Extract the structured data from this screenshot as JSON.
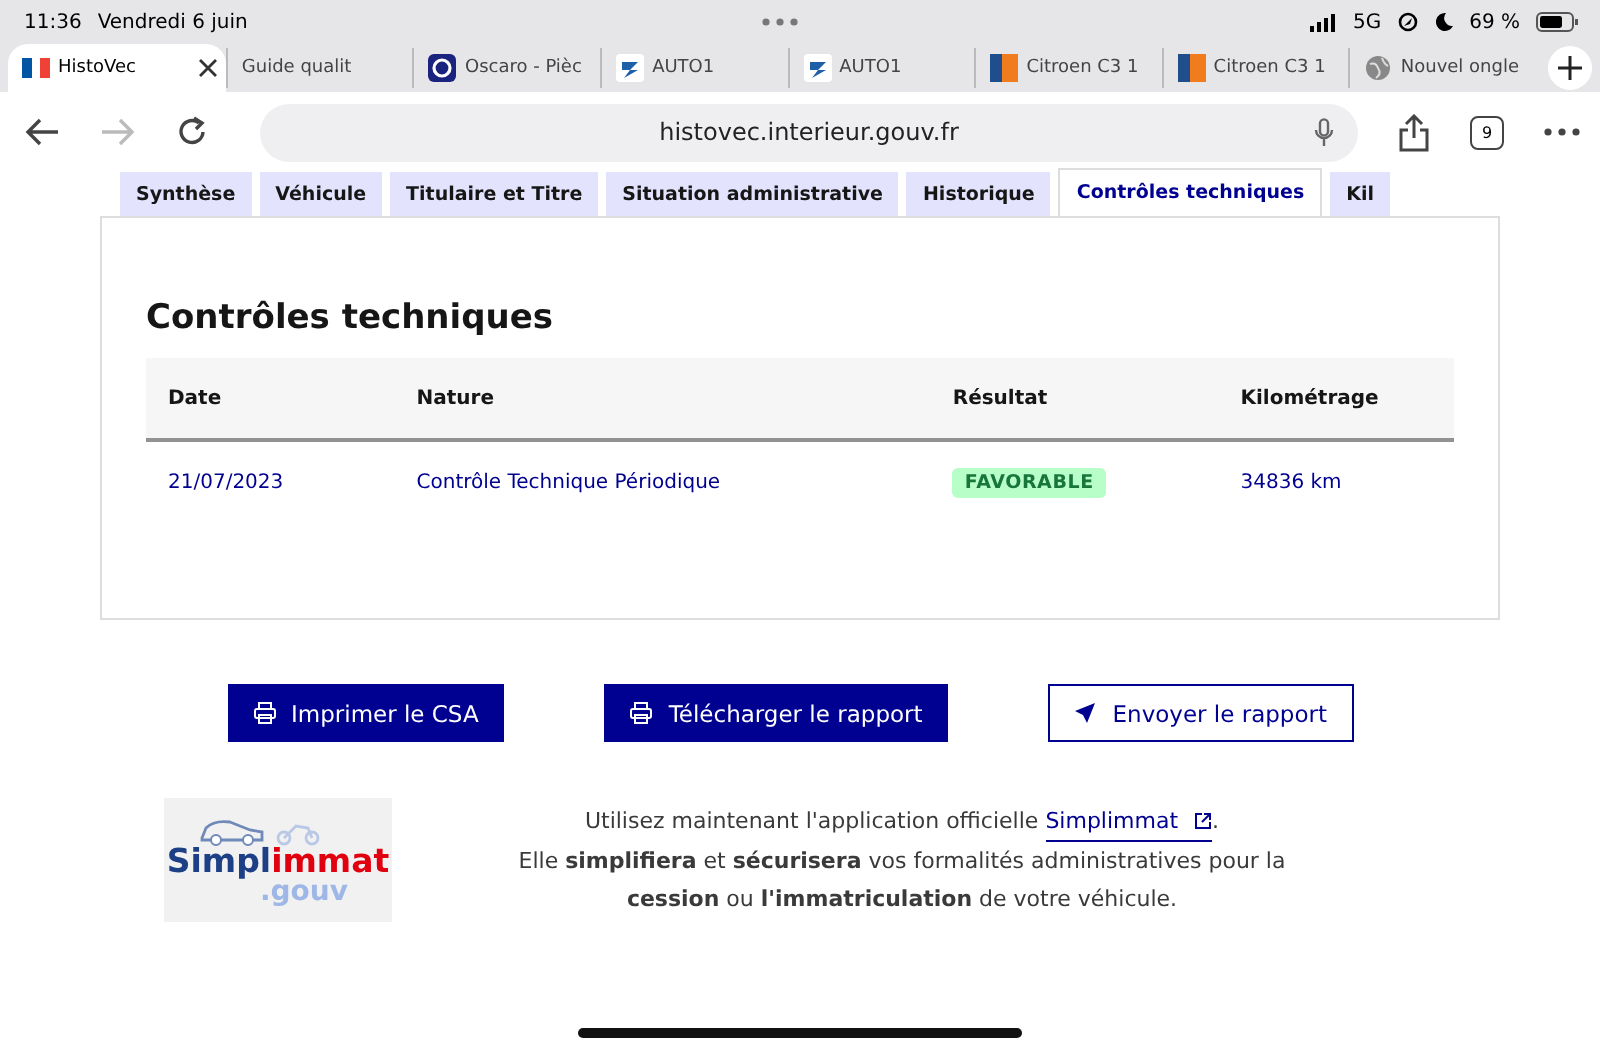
{
  "status_bar": {
    "time": "11:36",
    "date": "Vendredi 6 juin",
    "network": "5G",
    "battery": "69 %"
  },
  "browser_tabs": [
    {
      "title": "HistoVec",
      "selected": true
    },
    {
      "title": "Guide qualit",
      "selected": false
    },
    {
      "title": "Oscaro - Pièc",
      "selected": false
    },
    {
      "title": "AUTO1",
      "selected": false
    },
    {
      "title": "AUTO1",
      "selected": false
    },
    {
      "title": "Citroen C3 1",
      "selected": false
    },
    {
      "title": "Citroen C3 1",
      "selected": false
    },
    {
      "title": "Nouvel ongle",
      "selected": false
    }
  ],
  "toolbar": {
    "url": "histovec.interieur.gouv.fr",
    "tab_count": "9"
  },
  "page_tabs": [
    {
      "label": "Synthèse",
      "selected": false
    },
    {
      "label": "Véhicule",
      "selected": false
    },
    {
      "label": "Titulaire et Titre",
      "selected": false
    },
    {
      "label": "Situation administrative",
      "selected": false
    },
    {
      "label": "Historique",
      "selected": false
    },
    {
      "label": "Contrôles techniques",
      "selected": true
    },
    {
      "label": "Kil",
      "selected": false
    }
  ],
  "section": {
    "title": "Contrôles techniques",
    "table": {
      "columns": [
        "Date",
        "Nature",
        "Résultat",
        "Kilométrage"
      ],
      "rows": [
        {
          "date": "21/07/2023",
          "nature": "Contrôle Technique Périodique",
          "result": "FAVORABLE",
          "mileage": "34836 km"
        }
      ]
    }
  },
  "actions": [
    {
      "label": "Imprimer le CSA",
      "kind": "primary"
    },
    {
      "label": "Télécharger le rapport",
      "kind": "primary"
    },
    {
      "label": "Envoyer le rapport",
      "kind": "secondary"
    }
  ],
  "promo": {
    "logo": {
      "start": "Simpl",
      "end": "immat",
      "domain": ".gouv"
    },
    "before": "Utilisez maintenant l'application officielle",
    "link": "Simplimmat",
    "after": ".",
    "text": "Elle **simplifiera** et **sécurisera** vos formalités administratives pour la **cession** ou **l'immatriculation** de votre véhicule."
  }
}
